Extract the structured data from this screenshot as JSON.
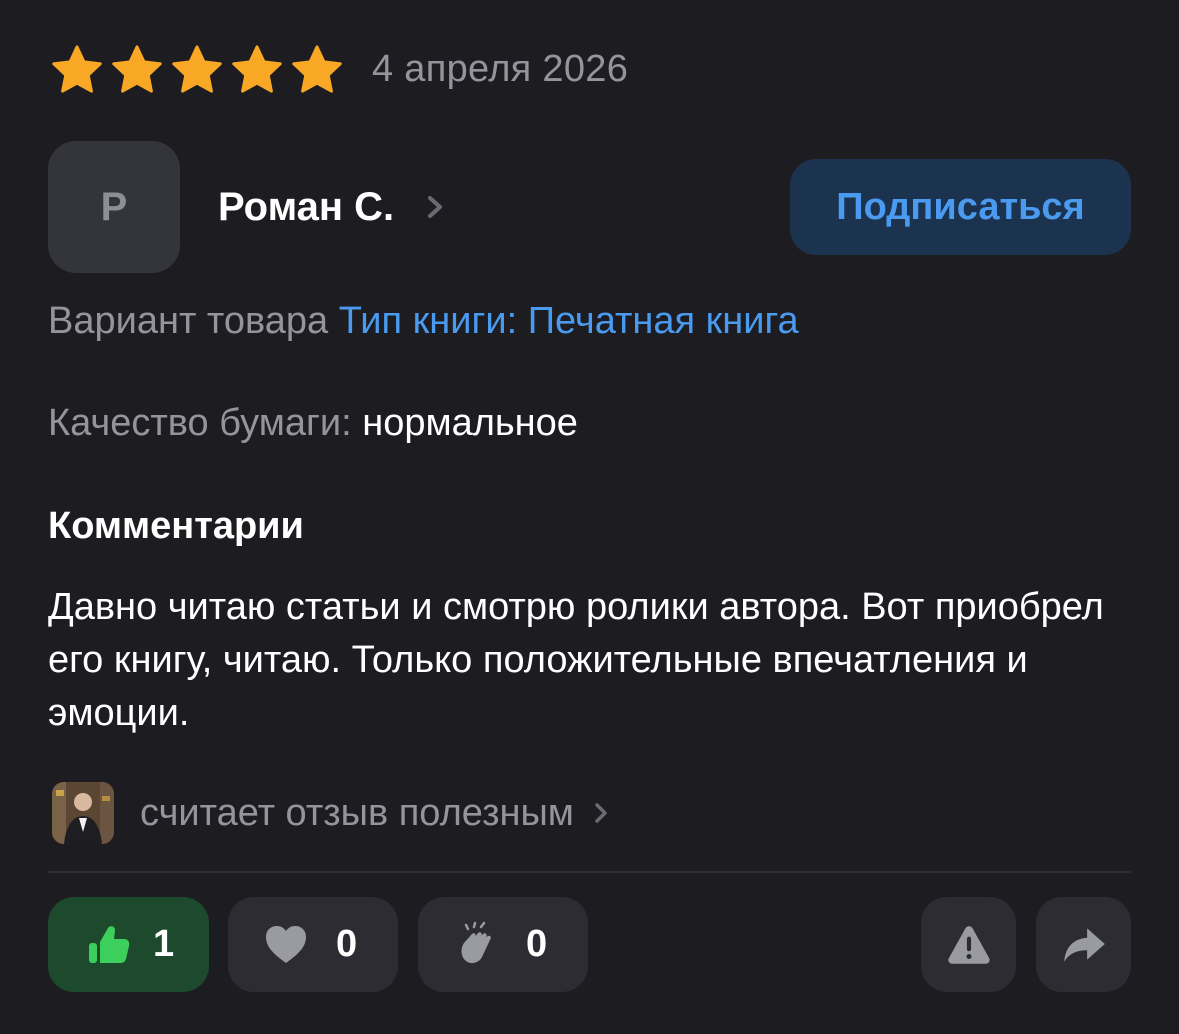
{
  "review": {
    "rating": 5,
    "rating_max": 5,
    "date": "4 апреля 2026"
  },
  "author": {
    "initial": "Р",
    "name": "Роман С.",
    "subscribe_label": "Подписаться"
  },
  "variant": {
    "label": "Вариант товара",
    "value": "Тип книги: Печатная книга"
  },
  "quality": {
    "label": "Качество бумаги:",
    "value": "нормальное"
  },
  "comments": {
    "title": "Комментарии",
    "text": "Давно читаю статьи и смотрю ролики автора. Вот приобрел его книгу, читаю. Только положительные впечатления и эмоции."
  },
  "helpful": {
    "text": "считает отзыв полезным"
  },
  "reactions": [
    {
      "icon": "thumbs-up-icon",
      "count": "1",
      "active": true
    },
    {
      "icon": "heart-icon",
      "count": "0",
      "active": false
    },
    {
      "icon": "clap-icon",
      "count": "0",
      "active": false
    }
  ],
  "actions": [
    {
      "icon": "report-warning-icon"
    },
    {
      "icon": "share-arrow-icon"
    }
  ],
  "colors": {
    "background": "#1c1c21",
    "star": "#f9a825",
    "link": "#4a9bf0",
    "muted_text": "#94949c",
    "like_active_bg": "#1d4a2c",
    "like_active_icon": "#3ccf5c",
    "subscribe_bg": "#1c3350"
  }
}
